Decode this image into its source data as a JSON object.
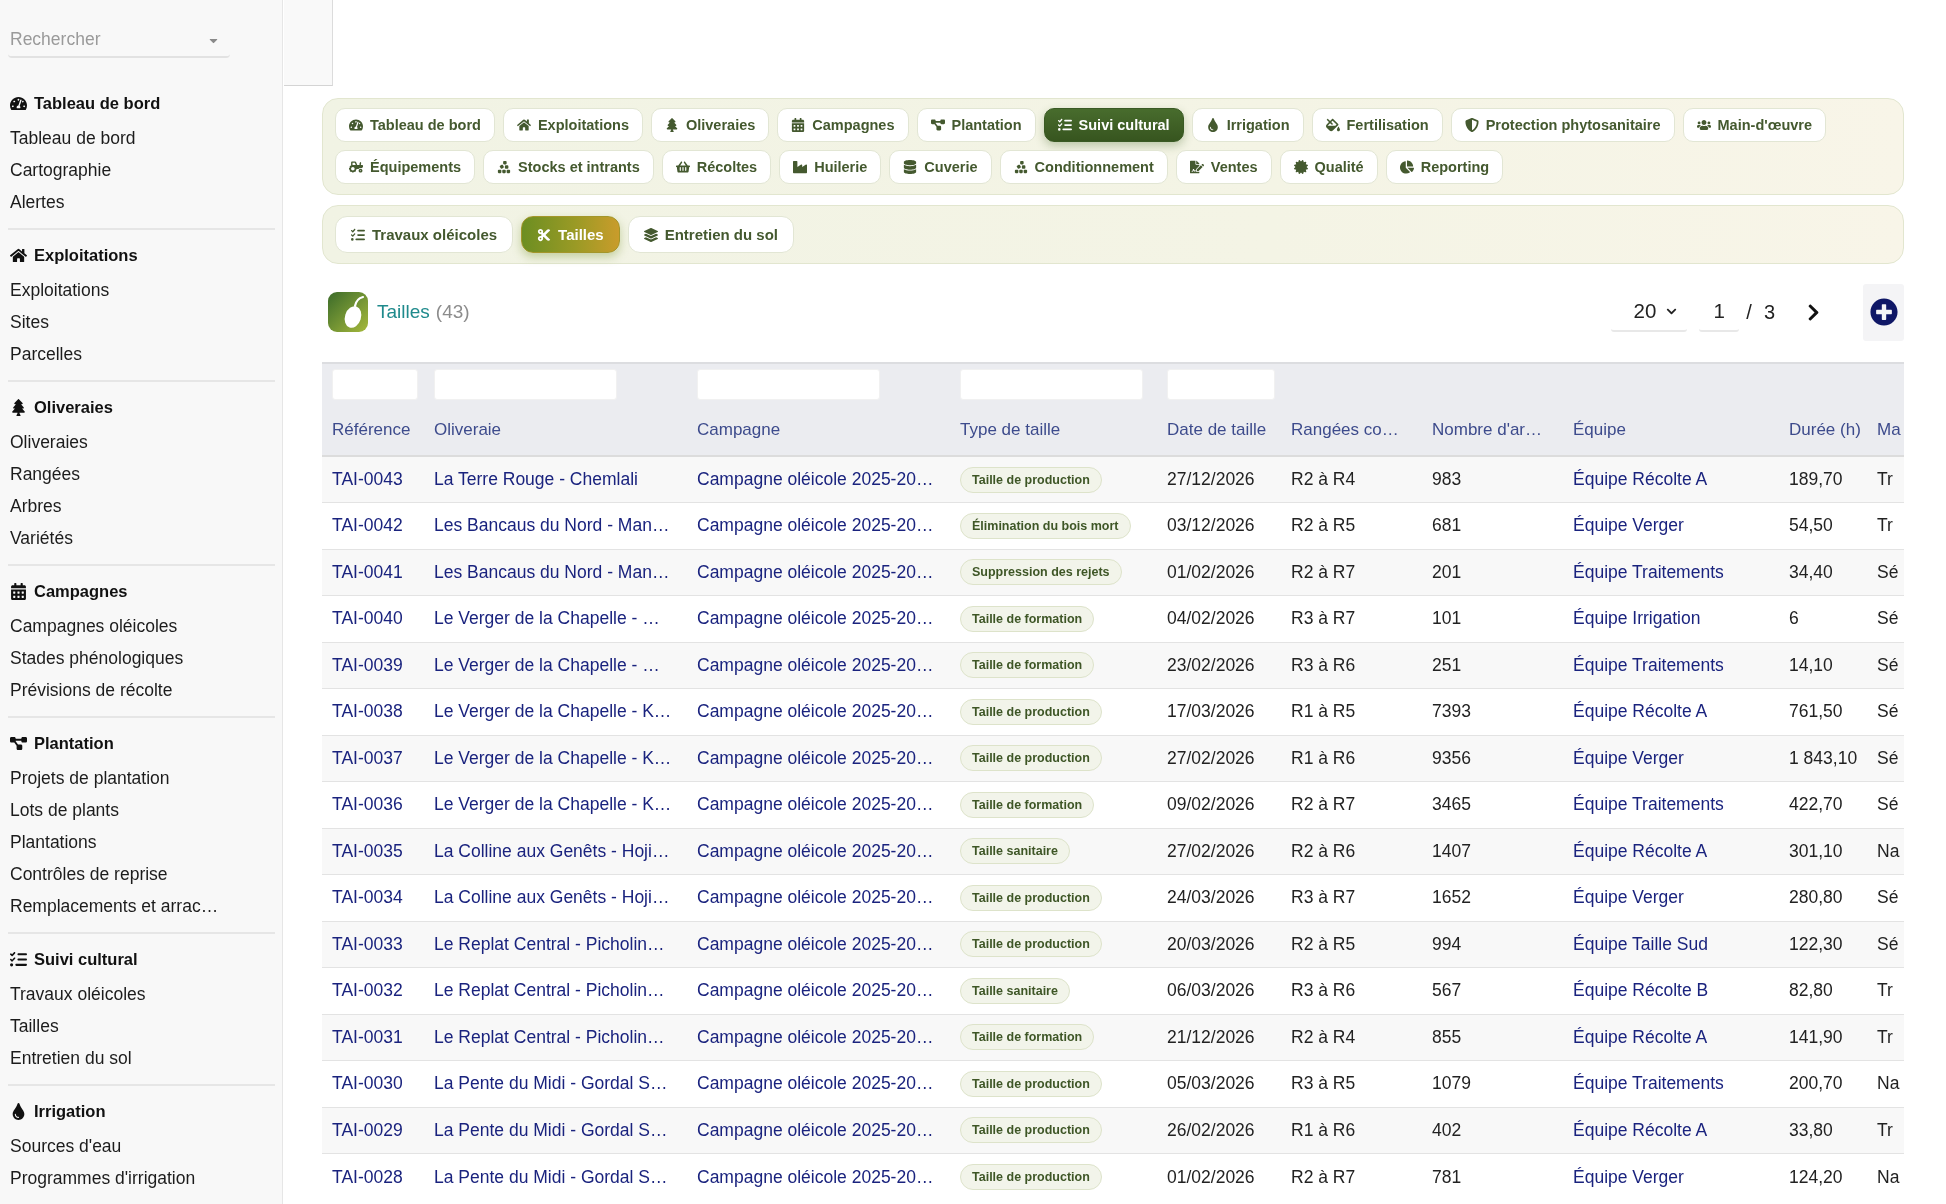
{
  "sidebar": {
    "search": {
      "placeholder": "Rechercher"
    },
    "sections": [
      {
        "title": "Tableau de bord",
        "items": [
          "Tableau de bord",
          "Cartographie",
          "Alertes"
        ]
      },
      {
        "title": "Exploitations",
        "items": [
          "Exploitations",
          "Sites",
          "Parcelles"
        ]
      },
      {
        "title": "Oliveraies",
        "items": [
          "Oliveraies",
          "Rangées",
          "Arbres",
          "Variétés"
        ]
      },
      {
        "title": "Campagnes",
        "items": [
          "Campagnes oléicoles",
          "Stades phénologiques",
          "Prévisions de récolte"
        ]
      },
      {
        "title": "Plantation",
        "items": [
          "Projets de plantation",
          "Lots de plants",
          "Plantations",
          "Contrôles de reprise",
          "Remplacements et arrac…"
        ]
      },
      {
        "title": "Suivi cultural",
        "items": [
          "Travaux oléicoles",
          "Tailles",
          "Entretien du sol"
        ]
      },
      {
        "title": "Irrigation",
        "items": [
          "Sources d'eau",
          "Programmes d'irrigation"
        ]
      }
    ]
  },
  "module_tabs": [
    {
      "label": "Tableau de bord",
      "selected": false
    },
    {
      "label": "Exploitations",
      "selected": false
    },
    {
      "label": "Oliveraies",
      "selected": false
    },
    {
      "label": "Campagnes",
      "selected": false
    },
    {
      "label": "Plantation",
      "selected": false
    },
    {
      "label": "Suivi cultural",
      "selected": true
    },
    {
      "label": "Irrigation",
      "selected": false
    },
    {
      "label": "Fertilisation",
      "selected": false
    },
    {
      "label": "Protection phytosanitaire",
      "selected": false
    },
    {
      "label": "Main-d'œuvre",
      "selected": false
    },
    {
      "label": "Équipements",
      "selected": false
    },
    {
      "label": "Stocks et intrants",
      "selected": false
    },
    {
      "label": "Récoltes",
      "selected": false
    },
    {
      "label": "Huilerie",
      "selected": false
    },
    {
      "label": "Cuverie",
      "selected": false
    },
    {
      "label": "Conditionnement",
      "selected": false
    },
    {
      "label": "Ventes",
      "selected": false
    },
    {
      "label": "Qualité",
      "selected": false
    },
    {
      "label": "Reporting",
      "selected": false
    }
  ],
  "sub_tabs": [
    {
      "label": "Travaux oléicoles",
      "selected": false
    },
    {
      "label": "Tailles",
      "selected": true
    },
    {
      "label": "Entretien du sol",
      "selected": false
    }
  ],
  "list": {
    "title": "Tailles",
    "count": "(43)",
    "page_size": "20",
    "page": "1",
    "page_separator": "/",
    "page_total": "3"
  },
  "table": {
    "columns": [
      {
        "label": "Référence",
        "kind": "link",
        "filter": true
      },
      {
        "label": "Oliveraie",
        "kind": "link",
        "filter": true
      },
      {
        "label": "Campagne",
        "kind": "link",
        "filter": true
      },
      {
        "label": "Type de taille",
        "kind": "badge",
        "filter": true
      },
      {
        "label": "Date de taille",
        "kind": "text",
        "filter": true
      },
      {
        "label": "Rangées co…",
        "kind": "text",
        "filter": false
      },
      {
        "label": "Nombre d'ar…",
        "kind": "text",
        "filter": false
      },
      {
        "label": "Équipe",
        "kind": "link",
        "filter": false
      },
      {
        "label": "Durée (h)",
        "kind": "text",
        "filter": false
      },
      {
        "label": "Ma",
        "kind": "text",
        "filter": false
      }
    ],
    "rows": [
      [
        "TAI-0043",
        "La Terre Rouge - Chemlali",
        "Campagne oléicole 2025-20…",
        "Taille de production",
        "27/12/2026",
        "R2 à R4",
        "983",
        "Équipe Récolte A",
        "189,70",
        "Tr"
      ],
      [
        "TAI-0042",
        "Les Bancaus du Nord - Man…",
        "Campagne oléicole 2025-20…",
        "Élimination du bois mort",
        "03/12/2026",
        "R2 à R5",
        "681",
        "Équipe Verger",
        "54,50",
        "Tr"
      ],
      [
        "TAI-0041",
        "Les Bancaus du Nord - Man…",
        "Campagne oléicole 2025-20…",
        "Suppression des rejets",
        "01/02/2026",
        "R2 à R7",
        "201",
        "Équipe Traitements",
        "34,40",
        "Sé"
      ],
      [
        "TAI-0040",
        "Le Verger de la Chapelle - …",
        "Campagne oléicole 2025-20…",
        "Taille de formation",
        "04/02/2026",
        "R3 à R7",
        "101",
        "Équipe Irrigation",
        "6",
        "Sé"
      ],
      [
        "TAI-0039",
        "Le Verger de la Chapelle - …",
        "Campagne oléicole 2025-20…",
        "Taille de formation",
        "23/02/2026",
        "R3 à R6",
        "251",
        "Équipe Traitements",
        "14,10",
        "Sé"
      ],
      [
        "TAI-0038",
        "Le Verger de la Chapelle - K…",
        "Campagne oléicole 2025-20…",
        "Taille de production",
        "17/03/2026",
        "R1 à R5",
        "7393",
        "Équipe Récolte A",
        "761,50",
        "Sé"
      ],
      [
        "TAI-0037",
        "Le Verger de la Chapelle - K…",
        "Campagne oléicole 2025-20…",
        "Taille de production",
        "27/02/2026",
        "R1 à R6",
        "9356",
        "Équipe Verger",
        "1 843,10",
        "Sé"
      ],
      [
        "TAI-0036",
        "Le Verger de la Chapelle - K…",
        "Campagne oléicole 2025-20…",
        "Taille de formation",
        "09/02/2026",
        "R2 à R7",
        "3465",
        "Équipe Traitements",
        "422,70",
        "Sé"
      ],
      [
        "TAI-0035",
        "La Colline aux Genêts - Hoji…",
        "Campagne oléicole 2025-20…",
        "Taille sanitaire",
        "27/02/2026",
        "R2 à R6",
        "1407",
        "Équipe Récolte A",
        "301,10",
        "Na"
      ],
      [
        "TAI-0034",
        "La Colline aux Genêts - Hoji…",
        "Campagne oléicole 2025-20…",
        "Taille de production",
        "24/03/2026",
        "R3 à R7",
        "1652",
        "Équipe Verger",
        "280,80",
        "Sé"
      ],
      [
        "TAI-0033",
        "Le Replat Central - Picholin…",
        "Campagne oléicole 2025-20…",
        "Taille de production",
        "20/03/2026",
        "R2 à R5",
        "994",
        "Équipe Taille Sud",
        "122,30",
        "Sé"
      ],
      [
        "TAI-0032",
        "Le Replat Central - Picholin…",
        "Campagne oléicole 2025-20…",
        "Taille sanitaire",
        "06/03/2026",
        "R3 à R6",
        "567",
        "Équipe Récolte B",
        "82,80",
        "Tr"
      ],
      [
        "TAI-0031",
        "Le Replat Central - Picholin…",
        "Campagne oléicole 2025-20…",
        "Taille de formation",
        "21/12/2026",
        "R2 à R4",
        "855",
        "Équipe Récolte A",
        "141,90",
        "Tr"
      ],
      [
        "TAI-0030",
        "La Pente du Midi - Gordal S…",
        "Campagne oléicole 2025-20…",
        "Taille de production",
        "05/03/2026",
        "R3 à R5",
        "1079",
        "Équipe Traitements",
        "200,70",
        "Na"
      ],
      [
        "TAI-0029",
        "La Pente du Midi - Gordal S…",
        "Campagne oléicole 2025-20…",
        "Taille de production",
        "26/02/2026",
        "R1 à R6",
        "402",
        "Équipe Récolte A",
        "33,80",
        "Tr"
      ],
      [
        "TAI-0028",
        "La Pente du Midi - Gordal S…",
        "Campagne oléicole 2025-20…",
        "Taille de production",
        "01/02/2026",
        "R2 à R7",
        "781",
        "Équipe Verger",
        "124,20",
        "Na"
      ]
    ]
  }
}
